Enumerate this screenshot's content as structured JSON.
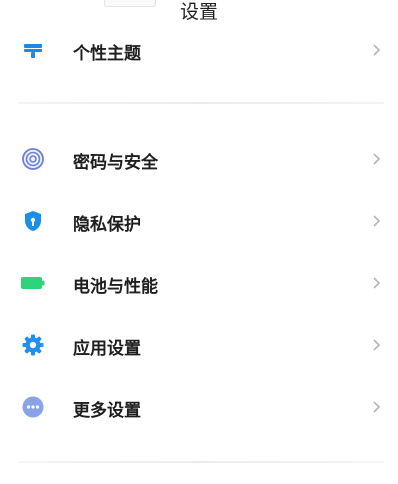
{
  "header": {
    "title": "设置"
  },
  "group1": [
    {
      "label": "个性主题",
      "icon": "theme-icon",
      "color": "#1e88e5"
    }
  ],
  "group2": [
    {
      "label": "密码与安全",
      "icon": "fingerprint-icon",
      "color": "#6e7fd8"
    },
    {
      "label": "隐私保护",
      "icon": "privacy-shield-icon",
      "color": "#1a8fe6"
    },
    {
      "label": "电池与性能",
      "icon": "battery-icon",
      "color": "#2fd37a"
    },
    {
      "label": "应用设置",
      "icon": "gear-icon",
      "color": "#1f8ff0"
    },
    {
      "label": "更多设置",
      "icon": "more-icon",
      "color": "#8aa3e6"
    }
  ],
  "colors": {
    "chevron": "#b5b5b5",
    "divider": "#ececec"
  }
}
